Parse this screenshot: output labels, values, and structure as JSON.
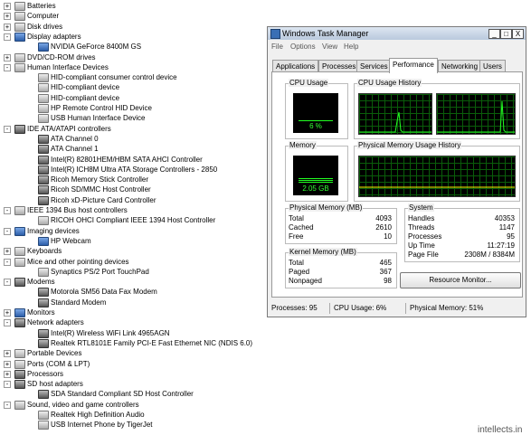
{
  "device_tree": [
    {
      "label": "Batteries",
      "toggle": "+",
      "icon": "battery-icon",
      "indent": 0
    },
    {
      "label": "Computer",
      "toggle": "+",
      "icon": "computer-icon",
      "indent": 0
    },
    {
      "label": "Disk drives",
      "toggle": "+",
      "icon": "disk-drive-icon",
      "indent": 0
    },
    {
      "label": "Display adapters",
      "toggle": "-",
      "icon": "display-adapter-icon",
      "indent": 0
    },
    {
      "label": "NVIDIA GeForce 8400M GS",
      "toggle": "",
      "icon": "display-adapter-icon",
      "indent": 1
    },
    {
      "label": "DVD/CD-ROM drives",
      "toggle": "+",
      "icon": "dvd-drive-icon",
      "indent": 0
    },
    {
      "label": "Human Interface Devices",
      "toggle": "-",
      "icon": "hid-icon",
      "indent": 0
    },
    {
      "label": "HID-compliant consumer control device",
      "toggle": "",
      "icon": "hid-icon",
      "indent": 1
    },
    {
      "label": "HID-compliant device",
      "toggle": "",
      "icon": "hid-icon",
      "indent": 1
    },
    {
      "label": "HID-compliant device",
      "toggle": "",
      "icon": "hid-icon",
      "indent": 1
    },
    {
      "label": "HP Remote Control HID Device",
      "toggle": "",
      "icon": "hid-icon",
      "indent": 1
    },
    {
      "label": "USB Human Interface Device",
      "toggle": "",
      "icon": "hid-icon",
      "indent": 1
    },
    {
      "label": "IDE ATA/ATAPI controllers",
      "toggle": "-",
      "icon": "ide-controller-icon",
      "indent": 0
    },
    {
      "label": "ATA Channel 0",
      "toggle": "",
      "icon": "ide-controller-icon",
      "indent": 1
    },
    {
      "label": "ATA Channel 1",
      "toggle": "",
      "icon": "ide-controller-icon",
      "indent": 1
    },
    {
      "label": "Intel(R) 82801HEM/HBM SATA AHCI Controller",
      "toggle": "",
      "icon": "ide-controller-icon",
      "indent": 1
    },
    {
      "label": "Intel(R) ICH8M Ultra ATA Storage Controllers - 2850",
      "toggle": "",
      "icon": "ide-controller-icon",
      "indent": 1
    },
    {
      "label": "Ricoh Memory Stick Controller",
      "toggle": "",
      "icon": "ide-controller-icon",
      "indent": 1
    },
    {
      "label": "Ricoh SD/MMC Host Controller",
      "toggle": "",
      "icon": "ide-controller-icon",
      "indent": 1
    },
    {
      "label": "Ricoh xD-Picture Card Controller",
      "toggle": "",
      "icon": "ide-controller-icon",
      "indent": 1
    },
    {
      "label": "IEEE 1394 Bus host controllers",
      "toggle": "-",
      "icon": "ieee1394-icon",
      "indent": 0
    },
    {
      "label": "RICOH OHCI Compliant IEEE 1394 Host Controller",
      "toggle": "",
      "icon": "ieee1394-icon",
      "indent": 1
    },
    {
      "label": "Imaging devices",
      "toggle": "-",
      "icon": "camera-icon",
      "indent": 0
    },
    {
      "label": "HP Webcam",
      "toggle": "",
      "icon": "camera-icon",
      "indent": 1
    },
    {
      "label": "Keyboards",
      "toggle": "+",
      "icon": "keyboard-icon",
      "indent": 0
    },
    {
      "label": "Mice and other pointing devices",
      "toggle": "-",
      "icon": "mouse-icon",
      "indent": 0
    },
    {
      "label": "Synaptics PS/2 Port TouchPad",
      "toggle": "",
      "icon": "mouse-icon",
      "indent": 1
    },
    {
      "label": "Modems",
      "toggle": "-",
      "icon": "modem-icon",
      "indent": 0
    },
    {
      "label": "Motorola SM56 Data Fax Modem",
      "toggle": "",
      "icon": "modem-icon",
      "indent": 1
    },
    {
      "label": "Standard Modem",
      "toggle": "",
      "icon": "modem-icon",
      "indent": 1
    },
    {
      "label": "Monitors",
      "toggle": "+",
      "icon": "monitor-icon",
      "indent": 0
    },
    {
      "label": "Network adapters",
      "toggle": "-",
      "icon": "network-adapter-icon",
      "indent": 0
    },
    {
      "label": "Intel(R) Wireless WiFi Link 4965AGN",
      "toggle": "",
      "icon": "network-adapter-icon",
      "indent": 1
    },
    {
      "label": "Realtek RTL8101E Family PCI-E Fast Ethernet NIC (NDIS 6.0)",
      "toggle": "",
      "icon": "network-adapter-icon",
      "indent": 1
    },
    {
      "label": "Portable Devices",
      "toggle": "+",
      "icon": "portable-device-icon",
      "indent": 0
    },
    {
      "label": "Ports (COM & LPT)",
      "toggle": "+",
      "icon": "port-icon",
      "indent": 0
    },
    {
      "label": "Processors",
      "toggle": "+",
      "icon": "processor-icon",
      "indent": 0
    },
    {
      "label": "SD host adapters",
      "toggle": "-",
      "icon": "sd-adapter-icon",
      "indent": 0
    },
    {
      "label": "SDA Standard Compliant SD Host Controller",
      "toggle": "",
      "icon": "sd-adapter-icon",
      "indent": 1
    },
    {
      "label": "Sound, video and game controllers",
      "toggle": "-",
      "icon": "speaker-icon",
      "indent": 0
    },
    {
      "label": "Realtek High Definition Audio",
      "toggle": "",
      "icon": "speaker-icon",
      "indent": 1
    },
    {
      "label": "USB Internet Phone by TigerJet",
      "toggle": "",
      "icon": "speaker-icon",
      "indent": 1
    }
  ],
  "task_manager": {
    "title": "Windows Task Manager",
    "window_buttons": {
      "minimize": "_",
      "maximize": "□",
      "close": "X"
    },
    "menu": [
      "File",
      "Options",
      "View",
      "Help"
    ],
    "tabs": [
      "Applications",
      "Processes",
      "Services",
      "Performance",
      "Networking",
      "Users"
    ],
    "active_tab": "Performance",
    "cpu_usage": {
      "title": "CPU Usage",
      "value_text": "6 %",
      "percent": 6
    },
    "cpu_history": {
      "title": "CPU Usage History"
    },
    "memory": {
      "title": "Memory",
      "value_text": "2.05 GB",
      "fraction": 0.25
    },
    "memory_history": {
      "title": "Physical Memory Usage History"
    },
    "physical_memory": {
      "title": "Physical Memory (MB)",
      "rows": [
        {
          "label": "Total",
          "value": "4093"
        },
        {
          "label": "Cached",
          "value": "2610"
        },
        {
          "label": "Free",
          "value": "10"
        }
      ]
    },
    "kernel_memory": {
      "title": "Kernel Memory (MB)",
      "rows": [
        {
          "label": "Total",
          "value": "465"
        },
        {
          "label": "Paged",
          "value": "367"
        },
        {
          "label": "Nonpaged",
          "value": "98"
        }
      ]
    },
    "system": {
      "title": "System",
      "rows": [
        {
          "label": "Handles",
          "value": "40353"
        },
        {
          "label": "Threads",
          "value": "1147"
        },
        {
          "label": "Processes",
          "value": "95"
        },
        {
          "label": "Up Time",
          "value": "11:27:19"
        },
        {
          "label": "Page File",
          "value": "2308M / 8384M"
        }
      ]
    },
    "resource_monitor_button": "Resource Monitor...",
    "status": {
      "processes": "Processes: 95",
      "cpu": "CPU Usage: 6%",
      "memory": "Physical Memory: 51%"
    }
  },
  "watermark": "intellects.in",
  "colors": {
    "graph_green": "#22ff22",
    "graph_grid": "#0a5d0a",
    "title_bar": "#c9d6e6"
  }
}
